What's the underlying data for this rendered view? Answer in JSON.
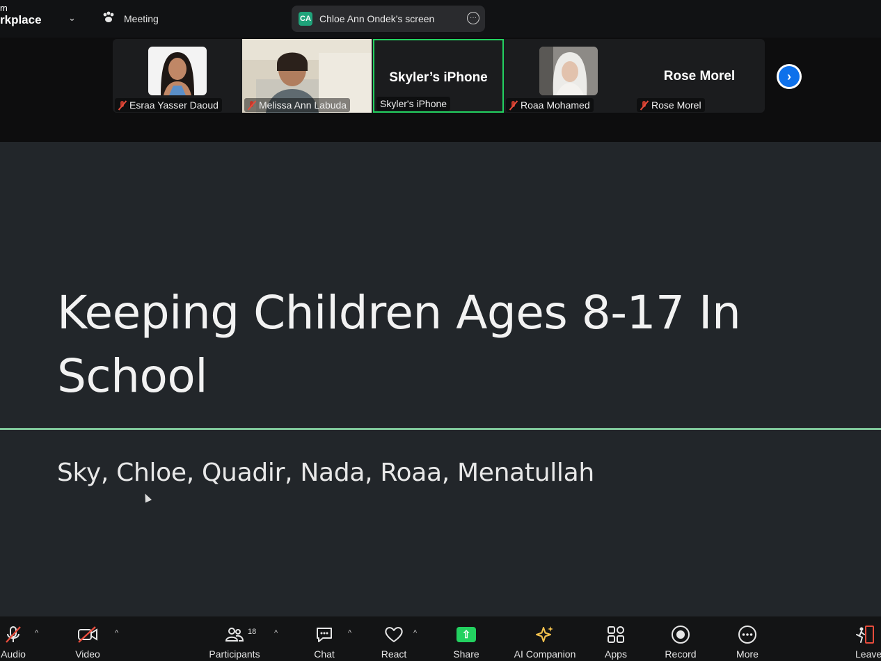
{
  "topbar": {
    "brand_line1": "m",
    "brand_line2": "rkplace",
    "meeting_label": "Meeting",
    "screen_initials": "CA",
    "screen_label": "Chloe Ann Ondek's screen"
  },
  "participants": [
    {
      "name": "Esraa Yasser Daoud",
      "muted": true,
      "video": true
    },
    {
      "name": "Melissa Ann Labuda",
      "muted": true,
      "video": true
    },
    {
      "name": "Skyler's iPhone",
      "big_name": "Skyler’s iPhone",
      "muted": false,
      "video": false,
      "active": true
    },
    {
      "name": "Roaa Mohamed",
      "muted": true,
      "video": true
    },
    {
      "name": "Rose Morel",
      "big_name": "Rose Morel",
      "muted": true,
      "video": false
    }
  ],
  "slide": {
    "title_line1": "Keeping Children Ages 8-17 In",
    "title_line2": "School",
    "subtitle": "Sky, Chloe, Quadir, Nada, Roaa, Menatullah"
  },
  "toolbar": {
    "audio": "Audio",
    "video": "Video",
    "participants": "Participants",
    "participants_count": "18",
    "chat": "Chat",
    "react": "React",
    "share": "Share",
    "ai_companion": "AI Companion",
    "apps": "Apps",
    "record": "Record",
    "more": "More",
    "leave": "Leave"
  },
  "colors": {
    "accent_green": "#23d160",
    "share_green": "#23d160",
    "next_blue": "#0e71eb",
    "muted_red": "#e74c3c",
    "slide_bg": "#22262a",
    "slide_rule": "#7fc69a",
    "ai_gold": "#f2c14e"
  }
}
